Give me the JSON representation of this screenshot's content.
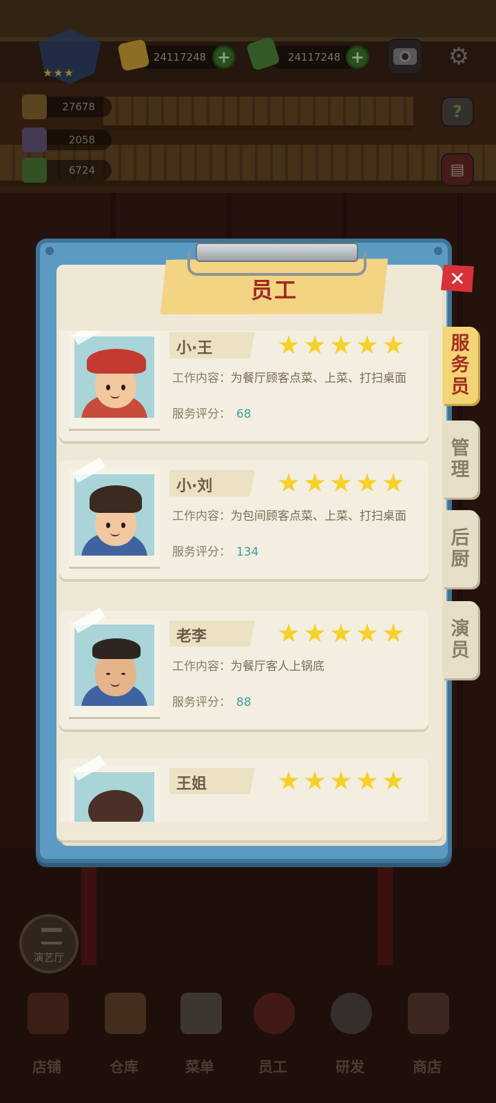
{
  "hud": {
    "gold": "24117248",
    "cash": "24117248",
    "stat1": "27678",
    "stat2": "2058",
    "stat3": "6724",
    "rank_stars": "★★★"
  },
  "panel": {
    "title": "员工",
    "close_label": "✕"
  },
  "tabs": [
    {
      "label": [
        "服",
        "务",
        "员"
      ],
      "active": true
    },
    {
      "label": [
        "管",
        "理"
      ],
      "active": false
    },
    {
      "label": [
        "后",
        "厨"
      ],
      "active": false
    },
    {
      "label": [
        "演",
        "员"
      ],
      "active": false
    }
  ],
  "staff": [
    {
      "name": "小·王",
      "stars": 5,
      "work_label": "工作内容：",
      "work": "为餐厅顾客点菜、上菜、打扫桌面",
      "rating_label": "服务评分：",
      "rating": "68"
    },
    {
      "name": "小·刘",
      "stars": 5,
      "work_label": "工作内容：",
      "work": "为包间顾客点菜、上菜、打扫桌面",
      "rating_label": "服务评分：",
      "rating": "134"
    },
    {
      "name": "老李",
      "stars": 5,
      "work_label": "工作内容：",
      "work": "为餐厅客人上锅底",
      "rating_label": "服务评分：",
      "rating": "88"
    },
    {
      "name": "王姐",
      "stars": 5,
      "work_label": "",
      "work": "",
      "rating_label": "",
      "rating": ""
    }
  ],
  "theatre_button": "演艺厅",
  "nav": [
    "店铺",
    "仓库",
    "菜单",
    "员工",
    "研发",
    "商店"
  ],
  "colors": {
    "panel_frame": "#5b9bc3",
    "title_red": "#9c2a22",
    "rating_teal": "#3b9fa6",
    "active_tab": "#f3d576",
    "close_red": "#d6323a",
    "star_yellow": "#f6d12a"
  },
  "icons": {
    "gold": "gold-ingot-icon",
    "cash": "cash-stack-icon",
    "camera": "camera-icon",
    "settings": "gear-icon",
    "guide": "book-question-icon",
    "menu_book": "recipe-book-icon"
  }
}
